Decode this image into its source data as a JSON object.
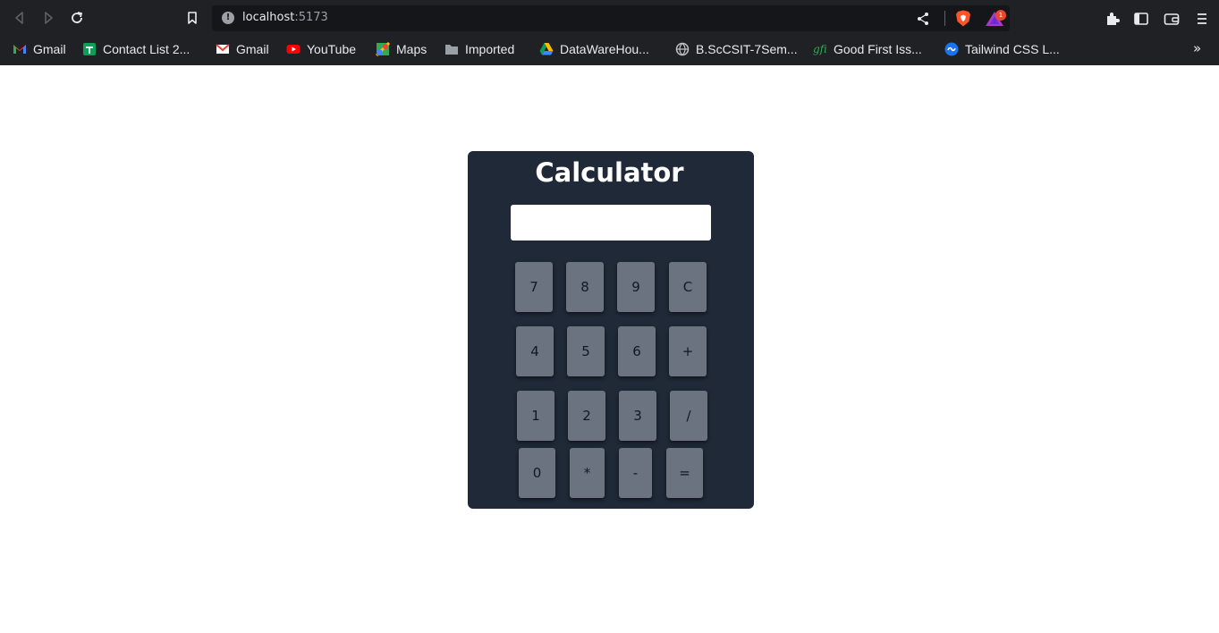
{
  "browser": {
    "url_host": "localhost",
    "url_port": ":5173",
    "rewards_badge": "1",
    "bookmarks": [
      {
        "label": "Gmail",
        "icon": "gmail-icon"
      },
      {
        "label": "Contact List 2...",
        "icon": "sheets-icon"
      },
      {
        "label": "Gmail",
        "icon": "gmail-icon"
      },
      {
        "label": "YouTube",
        "icon": "youtube-icon"
      },
      {
        "label": "Maps",
        "icon": "maps-icon"
      },
      {
        "label": "Imported",
        "icon": "folder-icon"
      },
      {
        "label": "DataWareHou...",
        "icon": "drive-icon"
      },
      {
        "label": "B.ScCSIT-7Sem...",
        "icon": "globe-icon"
      },
      {
        "label": "Good First Iss...",
        "icon": "gfi-icon"
      },
      {
        "label": "Tailwind CSS L...",
        "icon": "tailwind-icon"
      }
    ],
    "more_bookmarks": "»"
  },
  "calculator": {
    "title": "Calculator",
    "display_value": "",
    "keys": [
      "7",
      "8",
      "9",
      "C",
      "4",
      "5",
      "6",
      "+",
      "1",
      "2",
      "3",
      "/",
      "0",
      "*",
      "-",
      "="
    ]
  },
  "colors": {
    "chrome_bg": "#202124",
    "calc_bg": "#1f2937",
    "key_bg": "#6b7280"
  }
}
